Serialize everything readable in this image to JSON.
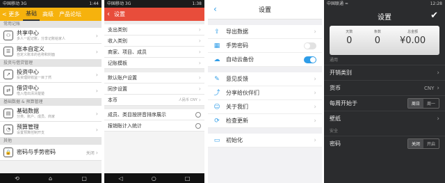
{
  "phone1": {
    "status_left": "中国移动 3G",
    "status_right": "1:44",
    "back_label": "< 更多",
    "tabs": [
      "基础",
      "高级",
      "产品论坛"
    ],
    "sections": [
      {
        "title": "常用记账",
        "rows": [
          {
            "icon_text": "⚇",
            "title": "共享中心",
            "sub": "多人一起记账，分享记账给家人"
          },
          {
            "icon_text": "☰",
            "title": "账本自定义",
            "sub": "自定义账本的名称和封面"
          }
        ]
      },
      {
        "title": "投资与借贷管理",
        "rows": [
          {
            "icon_text": "↗",
            "title": "投资中心",
            "sub": "投资理财收益一目了然"
          },
          {
            "icon_text": "⇄",
            "title": "借贷中心",
            "sub": "借入借出清清楚楚"
          }
        ]
      },
      {
        "title": "基础数据 & 预算管理",
        "rows": [
          {
            "icon_text": "▤",
            "title": "基础数据",
            "sub": "分类、账户、成员、商家"
          },
          {
            "icon_text": "◔",
            "title": "预算管理",
            "sub": "设置预算控制开支"
          }
        ]
      },
      {
        "title": "其他",
        "rows": [
          {
            "icon_text": "🔒",
            "title": "密码与手势密码",
            "right": "关闭"
          }
        ]
      }
    ]
  },
  "phone2": {
    "status_left": "中国移动 3G",
    "status_right": "1:38",
    "title": "设置",
    "group1": [
      "支出类别",
      "收入类别",
      "商家、项目、成员",
      "记账模板"
    ],
    "group2": [
      "默认账户设置",
      "同步设置"
    ],
    "currency_label": "本币",
    "currency_value": "人民币 CNY",
    "group3": [
      "成员、类目按拼音排序展示",
      "报销账计入统计"
    ]
  },
  "phone3": {
    "title": "设置",
    "group1": [
      {
        "icon": "export-icon",
        "glyph": "⇪",
        "label": "导出数据"
      },
      {
        "icon": "gesture-icon",
        "glyph": "▦",
        "label": "手势密码",
        "toggle": "off"
      },
      {
        "icon": "cloud-icon",
        "glyph": "☁",
        "label": "自动云备份",
        "toggle": "on"
      }
    ],
    "group2": [
      {
        "icon": "feedback-icon",
        "glyph": "✎",
        "label": "意见反馈"
      },
      {
        "icon": "share-icon",
        "glyph": "⤴",
        "label": "分享给伙伴们"
      },
      {
        "icon": "about-icon",
        "glyph": "☺",
        "label": "关于我们"
      },
      {
        "icon": "update-icon",
        "glyph": "⟳",
        "label": "检查更新"
      }
    ],
    "group3": [
      {
        "icon": "reset-icon",
        "glyph": "▭",
        "label": "初始化"
      }
    ]
  },
  "phone4": {
    "status_left": "中国联通 ≈",
    "status_right": "12:28",
    "title": "设置",
    "counter": [
      {
        "label": "天数",
        "value": "0"
      },
      {
        "label": "条数",
        "value": "0"
      },
      {
        "label": "总金额",
        "value": "¥0.00"
      }
    ],
    "section_general": "通用",
    "expense_label": "开销类别",
    "currency_label": "货币",
    "currency_value": "CNY",
    "week_start_label": "每周开始于",
    "week_options": [
      "周日",
      "周一"
    ],
    "wallpaper_label": "壁纸",
    "section_security": "安全",
    "password_label": "密码",
    "password_options": [
      "关闭",
      "开启"
    ]
  }
}
